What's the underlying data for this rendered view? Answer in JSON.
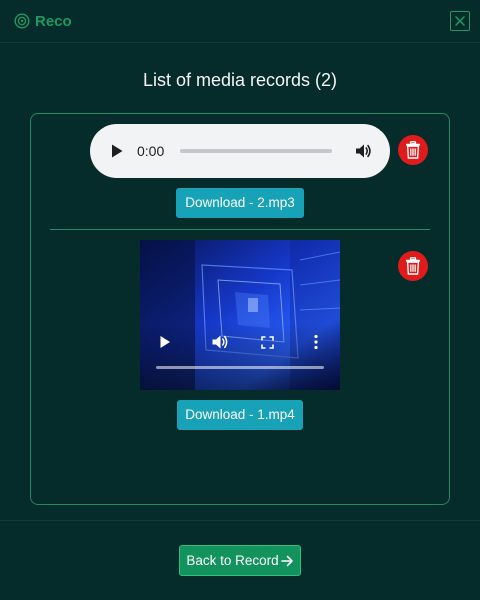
{
  "app": {
    "name": "Reco",
    "accent_color": "#1c9a62",
    "logo_icon": "reco-logo-icon",
    "close_icon": "close-icon"
  },
  "main": {
    "title": "List of media records (2)"
  },
  "records": [
    {
      "type": "audio",
      "current_time": "0:00",
      "progress": 0,
      "download_label": "Download - 2.mp3",
      "delete_icon": "trash-icon"
    },
    {
      "type": "video",
      "progress": 0,
      "download_label": "Download - 1.mp4",
      "delete_icon": "trash-icon"
    }
  ],
  "footer": {
    "back_label": "Back to Record",
    "back_icon": "arrow-right-icon",
    "button_color": "#12925c"
  },
  "colors": {
    "background": "#052c2a",
    "panel_border": "#1f8a63",
    "download_button": "#17a2b8",
    "delete_button": "#e01b1b"
  }
}
